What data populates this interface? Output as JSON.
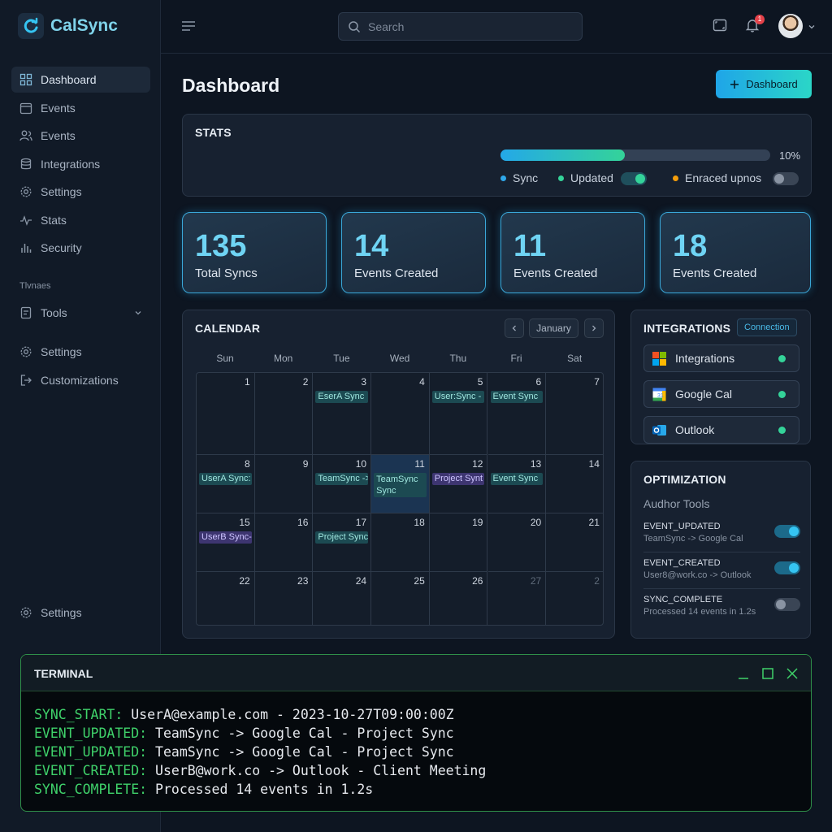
{
  "app": {
    "name": "CalSync"
  },
  "search": {
    "placeholder": "Search"
  },
  "header": {
    "notification_count": "1"
  },
  "sidebar": {
    "items": [
      {
        "label": "Dashboard",
        "icon": "grid-icon"
      },
      {
        "label": "Events",
        "icon": "calendar-icon"
      },
      {
        "label": "Events",
        "icon": "users-icon"
      },
      {
        "label": "Integrations",
        "icon": "database-icon"
      },
      {
        "label": "Settings",
        "icon": "gear-icon"
      },
      {
        "label": "Stats",
        "icon": "activity-icon"
      },
      {
        "label": "Security",
        "icon": "bar-chart-icon"
      }
    ],
    "section_label": "Tlvnaes",
    "tools_label": "Tools",
    "lower_items": [
      {
        "label": "Settings",
        "icon": "gear-icon"
      },
      {
        "label": "Customizations",
        "icon": "logout-icon"
      }
    ],
    "footer_label": "Settings"
  },
  "page": {
    "title": "Dashboard",
    "primary_button": "Dashboard"
  },
  "stats_panel": {
    "title": "STATS",
    "progress_percent": 10,
    "progress_label": "10%",
    "progress_fill_fraction": 0.46,
    "legend": [
      {
        "label": "Sync",
        "color": "#2fa8ea"
      },
      {
        "label": "Updated",
        "color": "#34d399",
        "toggle_on": true
      },
      {
        "label": "Enraced upnos",
        "color": "#f59e0b",
        "toggle_on": false
      }
    ]
  },
  "stat_cards": [
    {
      "value": "135",
      "label": "Total Syncs"
    },
    {
      "value": "14",
      "label": "Events Created"
    },
    {
      "value": "11",
      "label": "Events Created"
    },
    {
      "value": "18",
      "label": "Events Created"
    }
  ],
  "calendar": {
    "title": "CALENDAR",
    "month": "January",
    "weekdays": [
      "Sun",
      "Mon",
      "Tue",
      "Wed",
      "Thu",
      "Fri",
      "Sat"
    ],
    "weeks": [
      [
        {
          "d": "1"
        },
        {
          "d": "2"
        },
        {
          "d": "3",
          "event": "EserA Sync",
          "kind": "teal"
        },
        {
          "d": "4"
        },
        {
          "d": "5",
          "event": "User:Sync -",
          "kind": "teal"
        },
        {
          "d": "6",
          "event": "Event Sync",
          "kind": "teal"
        },
        {
          "d": "7"
        }
      ],
      [
        {
          "d": "8",
          "event": "UserA Sync:",
          "kind": "teal"
        },
        {
          "d": "9"
        },
        {
          "d": "10",
          "event": "TeamSync ->",
          "kind": "teal"
        },
        {
          "d": "11",
          "event": "TeamSync Sync",
          "kind": "teal",
          "today": true
        },
        {
          "d": "12",
          "event": "Project Synt",
          "kind": "purple"
        },
        {
          "d": "13",
          "event": "Event Sync",
          "kind": "teal"
        },
        {
          "d": "14"
        }
      ],
      [
        {
          "d": "15",
          "event": "UserB Sync-",
          "kind": "purple"
        },
        {
          "d": "16"
        },
        {
          "d": "17",
          "event": "Project Sync",
          "kind": "teal"
        },
        {
          "d": "18"
        },
        {
          "d": "19"
        },
        {
          "d": "20"
        },
        {
          "d": "21"
        }
      ],
      [
        {
          "d": "22"
        },
        {
          "d": "23"
        },
        {
          "d": "24"
        },
        {
          "d": "25"
        },
        {
          "d": "26"
        },
        {
          "d": "27",
          "muted": true
        },
        {
          "d": "2",
          "muted": true
        }
      ]
    ]
  },
  "integrations": {
    "title": "INTEGRATIONS",
    "badge": "Connection",
    "items": [
      {
        "label": "Integrations",
        "icon": "microsoft-logo-icon",
        "status_color": "#34d399"
      },
      {
        "label": "Google Cal",
        "icon": "google-calendar-icon",
        "status_color": "#34d399"
      },
      {
        "label": "Outlook",
        "icon": "outlook-icon",
        "status_color": "#34d399"
      }
    ]
  },
  "optimization": {
    "title": "OPTIMIZATION",
    "subtitle": "Audhor Tools",
    "rows": [
      {
        "key": "EVENT_UPDATED",
        "value": "TeamSync -> Google Cal",
        "on": true
      },
      {
        "key": "EVENT_CREATED",
        "value": "User8@work.co -> Outlook",
        "on": true
      },
      {
        "key": "SYNC_COMPLETE",
        "value": "Processed 14 events in 1.2s",
        "on": false
      }
    ]
  },
  "terminal": {
    "title": "TERMINAL",
    "lines": [
      {
        "key": "SYNC_START:",
        "text": " UserA@example.com - 2023-10-27T09:00:00Z"
      },
      {
        "key": "EVENT_UPDATED:",
        "text": " TeamSync -> Google Cal - Project Sync"
      },
      {
        "key": "EVENT_UPDATED:",
        "text": " TeamSync -> Google Cal - Project Sync"
      },
      {
        "key": "EVENT_CREATED:",
        "text": " UserB@work.co -> Outlook - Client Meeting"
      },
      {
        "key": "SYNC_COMPLETE:",
        "text": " Processed 14 events in 1.2s"
      }
    ]
  },
  "colors": {
    "accent": "#2fa8ea",
    "success": "#34d399",
    "terminal_green": "#3fd16a"
  }
}
